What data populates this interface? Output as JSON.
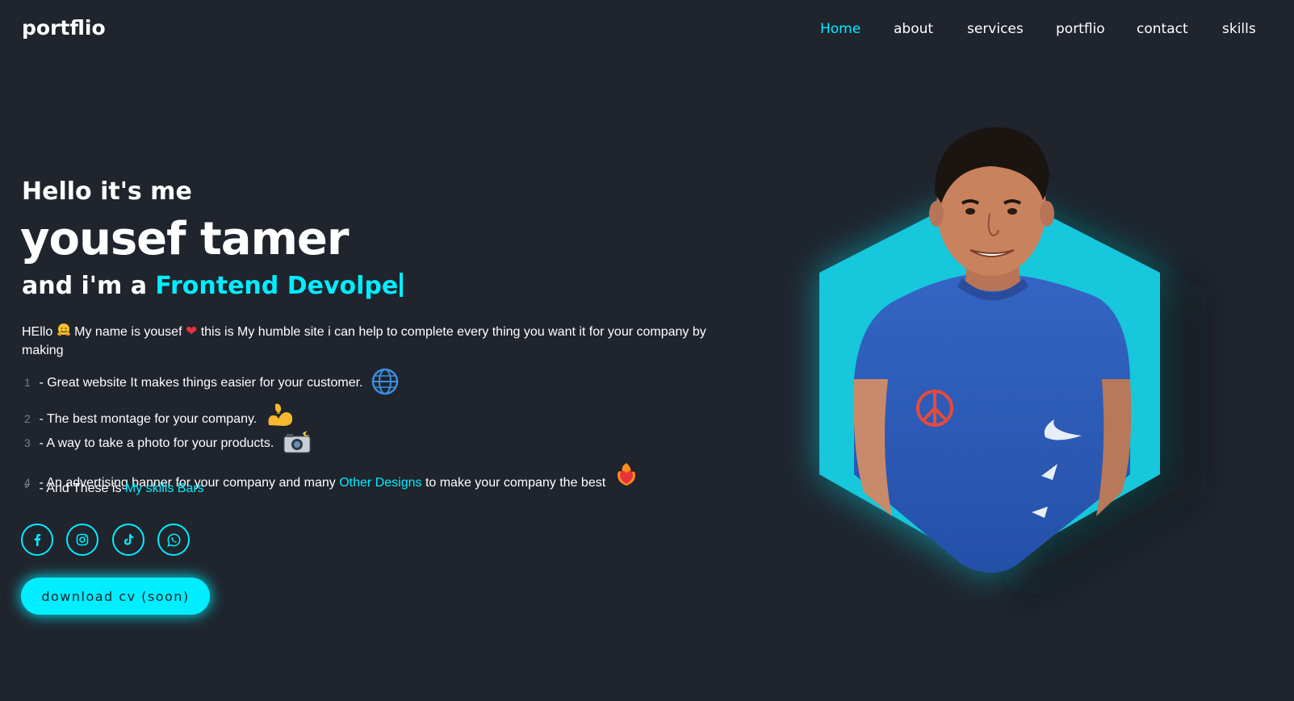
{
  "header": {
    "logo": "portflio",
    "nav": [
      {
        "label": "Home",
        "active": true
      },
      {
        "label": "about",
        "active": false
      },
      {
        "label": "services",
        "active": false
      },
      {
        "label": "portflio",
        "active": false
      },
      {
        "label": "contact",
        "active": false
      },
      {
        "label": "skills",
        "active": false
      }
    ]
  },
  "hero": {
    "greeting": "Hello it's me",
    "name": "yousef tamer",
    "role_prefix": "and i'm a",
    "role_typed": "Frontend Devolpe",
    "intro_part1": "HEllo",
    "intro_part2": "My name is yousef",
    "intro_part3": "this is My humble site i can help to complete every thing you want it for your company by making",
    "list": [
      {
        "num": "1",
        "text": "- Great website It makes things easier for your customer.",
        "icon": "globe-icon"
      },
      {
        "num": "2",
        "text": "- The best montage for your company.",
        "icon": "flexed-biceps-icon"
      },
      {
        "num": "3",
        "text": "- A way to take a photo for your products.",
        "icon": "camera-flash-icon"
      },
      {
        "num": "4",
        "text_before": "- An advertising banner for your company and many",
        "link": "Other Designs",
        "text_after": "to make your company the best",
        "icon": "heart-on-fire-icon"
      },
      {
        "num": "*",
        "text_before": "- And These is",
        "link": "My skills Bars"
      }
    ],
    "socials": [
      "facebook-icon",
      "instagram-icon",
      "tiktok-icon",
      "whatsapp-icon"
    ],
    "cta": "download cv (soon)"
  },
  "colors": {
    "background": "#1f242d",
    "accent": "#00eeff",
    "text": "#ffffff",
    "hexagon": "#16c8dc",
    "shirt": "#2f5bb5"
  }
}
